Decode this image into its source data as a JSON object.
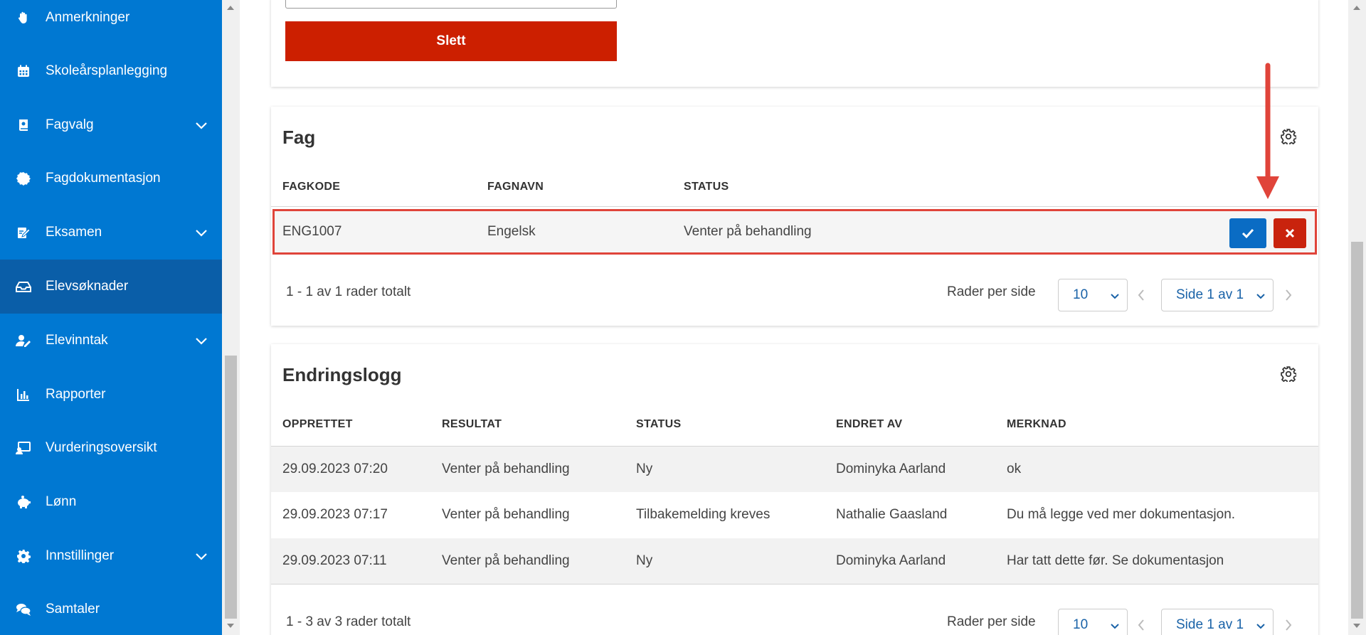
{
  "sidebar": {
    "items": [
      {
        "label": "Anmerkninger",
        "icon": "hand-icon",
        "has_children": false,
        "active": false
      },
      {
        "label": "Skoleårsplanlegging",
        "icon": "calendar-icon",
        "has_children": false,
        "active": false
      },
      {
        "label": "Fagvalg",
        "icon": "book-icon",
        "has_children": true,
        "active": false
      },
      {
        "label": "Fagdokumentasjon",
        "icon": "badge-icon",
        "has_children": false,
        "active": false
      },
      {
        "label": "Eksamen",
        "icon": "exam-icon",
        "has_children": true,
        "active": false
      },
      {
        "label": "Elevsøknader",
        "icon": "inbox-icon",
        "has_children": false,
        "active": true
      },
      {
        "label": "Elevinntak",
        "icon": "user-edit-icon",
        "has_children": true,
        "active": false
      },
      {
        "label": "Rapporter",
        "icon": "bar-chart-icon",
        "has_children": false,
        "active": false
      },
      {
        "label": "Vurderingsoversikt",
        "icon": "screen-user-icon",
        "has_children": false,
        "active": false
      },
      {
        "label": "Lønn",
        "icon": "piggy-bank-icon",
        "has_children": false,
        "active": false
      },
      {
        "label": "Innstillinger",
        "icon": "gear-icon",
        "has_children": true,
        "active": false
      },
      {
        "label": "Samtaler",
        "icon": "chat-icon",
        "has_children": false,
        "active": false
      }
    ]
  },
  "top_card": {
    "delete_label": "Slett"
  },
  "fag": {
    "title": "Fag",
    "columns": [
      "FAGKODE",
      "FAGNAVN",
      "STATUS"
    ],
    "rows": [
      {
        "fagkode": "ENG1007",
        "fagnavn": "Engelsk",
        "status": "Venter på behandling"
      }
    ],
    "footer": {
      "total_text": "1 - 1 av 1 rader totalt",
      "rows_per_page_label": "Rader per side",
      "rows_per_page_value": "10",
      "page_value": "Side 1 av 1"
    }
  },
  "log": {
    "title": "Endringslogg",
    "columns": [
      "OPPRETTET",
      "RESULTAT",
      "STATUS",
      "ENDRET AV",
      "MERKNAD"
    ],
    "rows": [
      {
        "opprettet": "29.09.2023 07:20",
        "resultat": "Venter på behandling",
        "status": "Ny",
        "endret_av": "Dominyka Aarland",
        "merknad": "ok"
      },
      {
        "opprettet": "29.09.2023 07:17",
        "resultat": "Venter på behandling",
        "status": "Tilbakemelding kreves",
        "endret_av": "Nathalie Gaasland",
        "merknad": "Du må legge ved mer dokumentasjon."
      },
      {
        "opprettet": "29.09.2023 07:11",
        "resultat": "Venter på behandling",
        "status": "Ny",
        "endret_av": "Dominyka Aarland",
        "merknad": "Har tatt dette før. Se dokumentasjon"
      }
    ],
    "footer": {
      "total_text": "1 - 3 av 3 rader totalt",
      "rows_per_page_label": "Rader per side",
      "rows_per_page_value": "10",
      "page_value": "Side 1 av 1"
    }
  },
  "colors": {
    "sidebar_bg": "#0078d2",
    "sidebar_active": "#0a5ea8",
    "delete_red": "#cc1f00",
    "approve_blue": "#0a6cc4",
    "annotation_red": "#e0443a"
  }
}
